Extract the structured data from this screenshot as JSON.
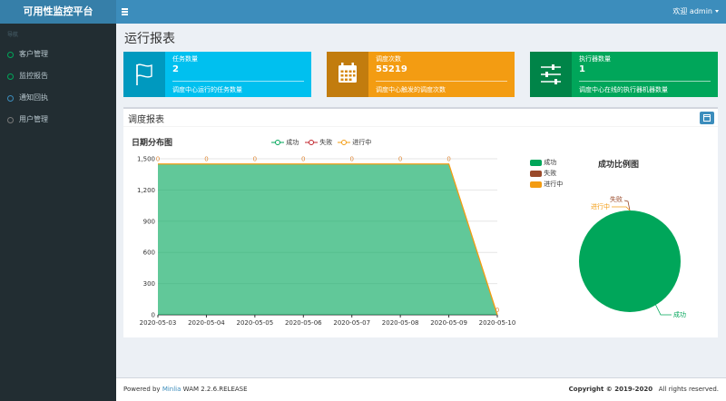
{
  "app": {
    "title": "可用性监控平台",
    "user_label": "欢迎 admin"
  },
  "sidebar": {
    "header": "导航",
    "items": [
      {
        "label": "客户管理",
        "color": "#00a65a"
      },
      {
        "label": "监控报告",
        "color": "#00a65a"
      },
      {
        "label": "通知回执",
        "color": "#3c8dbc"
      },
      {
        "label": "用户管理",
        "color": "#777777"
      }
    ]
  },
  "page": {
    "title": "运行报表"
  },
  "info_boxes": [
    {
      "label": "任务数量",
      "value": "2",
      "description": "调度中心运行的任务数量",
      "color": "#00c0ef",
      "icon": "flag-icon"
    },
    {
      "label": "调度次数",
      "value": "55219",
      "description": "调度中心触发的调度次数",
      "color": "#f39c12",
      "icon": "calendar-icon"
    },
    {
      "label": "执行器数量",
      "value": "1",
      "description": "调度中心在线的执行器机器数量",
      "color": "#00a65a",
      "icon": "sliders-icon"
    }
  ],
  "report": {
    "title": "调度报表",
    "line_title": "日期分布图",
    "pie_title": "成功比例图"
  },
  "chart_data": [
    {
      "type": "area",
      "title": "日期分布图",
      "x": [
        "2020-05-03",
        "2020-05-04",
        "2020-05-05",
        "2020-05-06",
        "2020-05-07",
        "2020-05-08",
        "2020-05-09",
        "2020-05-10"
      ],
      "series": [
        {
          "name": "成功",
          "values": [
            1450,
            1450,
            1450,
            1450,
            1450,
            1450,
            1450,
            0
          ],
          "color": "#00a65a"
        },
        {
          "name": "失败",
          "values": [
            0,
            0,
            0,
            0,
            0,
            0,
            0,
            0
          ],
          "color": "#c1232b"
        },
        {
          "name": "进行中",
          "values": [
            0,
            0,
            0,
            0,
            0,
            0,
            0,
            0
          ],
          "color": "#f39c12"
        }
      ],
      "point_labels": [
        "0",
        "0",
        "0",
        "0",
        "0",
        "0",
        "0",
        "0"
      ],
      "y_ticks": [
        "0",
        "300",
        "600",
        "900",
        "1,200",
        "1,500"
      ],
      "ylim": [
        0,
        1500
      ],
      "grid": true,
      "legend": "top-center"
    },
    {
      "type": "pie",
      "title": "成功比例图",
      "categories": [
        "成功",
        "失败",
        "进行中"
      ],
      "values": [
        100,
        0,
        0
      ],
      "colors": [
        "#00a65a",
        "#9a4a2a",
        "#f39c12"
      ],
      "legend": "top-left"
    }
  ],
  "footer": {
    "powered_prefix": "Powered by",
    "brand": "Minlia",
    "product": "WAM 2.2.6.RELEASE",
    "copyright": "Copyright © 2019-2020",
    "rights": "All rights reserved."
  }
}
